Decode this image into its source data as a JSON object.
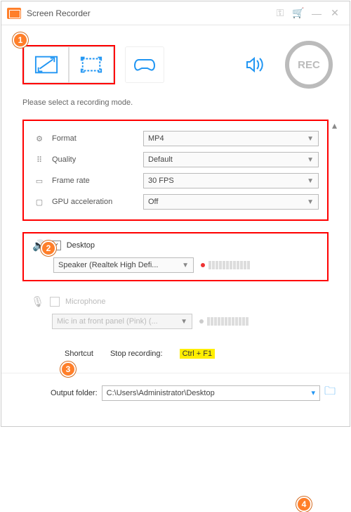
{
  "title": "Screen Recorder",
  "rec_label": "REC",
  "instruction": "Please select a recording mode.",
  "settings": {
    "format": {
      "label": "Format",
      "value": "MP4"
    },
    "quality": {
      "label": "Quality",
      "value": "Default"
    },
    "fps": {
      "label": "Frame rate",
      "value": "30 FPS"
    },
    "gpu": {
      "label": "GPU acceleration",
      "value": "Off"
    }
  },
  "audio": {
    "desktop": {
      "label": "Desktop",
      "checked": true,
      "device": "Speaker (Realtek High Defi..."
    },
    "mic": {
      "label": "Microphone",
      "checked": false,
      "device": "Mic in at front panel (Pink) (..."
    }
  },
  "shortcut": {
    "label": "Shortcut",
    "stop_label": "Stop recording:",
    "stop_key": "Ctrl + F1"
  },
  "output": {
    "label": "Output folder:",
    "path": "C:\\Users\\Administrator\\Desktop"
  },
  "badges": {
    "b1": "1",
    "b2": "2",
    "b3": "3",
    "b4": "4"
  }
}
